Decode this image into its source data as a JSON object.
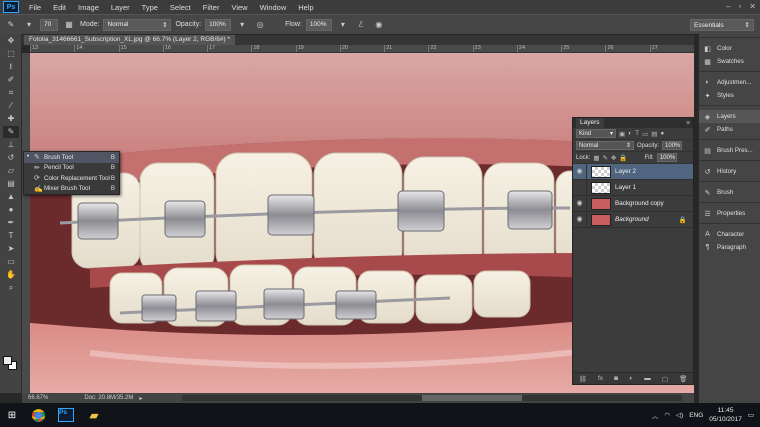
{
  "app": {
    "logo": "Ps",
    "menu": [
      "File",
      "Edit",
      "Image",
      "Layer",
      "Type",
      "Select",
      "Filter",
      "View",
      "Window",
      "Help"
    ]
  },
  "options_bar": {
    "brush_size": "70",
    "mode_label": "Mode:",
    "mode_value": "Normal",
    "opacity_label": "Opacity:",
    "opacity_value": "100%",
    "flow_label": "Flow:",
    "flow_value": "100%",
    "workspace": "Essentials"
  },
  "document": {
    "tab_title": "Fotolia_31466661_Subscription_XL.jpg @ 66.7% (Layer 2, RGB/8#) *",
    "ruler_ticks": [
      "13",
      "14",
      "15",
      "16",
      "17",
      "18",
      "19",
      "20",
      "21",
      "22",
      "23",
      "24",
      "25",
      "26",
      "27"
    ],
    "zoom": "66.67%",
    "doc_size": "Doc: 20.8M/35.2M"
  },
  "tool_flyout": {
    "items": [
      {
        "label": "Brush Tool",
        "key": "B",
        "icon": "brush-icon",
        "selected": true
      },
      {
        "label": "Pencil Tool",
        "key": "B",
        "icon": "pencil-icon",
        "selected": false
      },
      {
        "label": "Color Replacement Tool",
        "key": "B",
        "icon": "color-replacement-icon",
        "selected": false
      },
      {
        "label": "Mixer Brush Tool",
        "key": "B",
        "icon": "mixer-brush-icon",
        "selected": false
      }
    ]
  },
  "layers_panel": {
    "title": "Layers",
    "filter_kind": "Kind",
    "blend_mode": "Normal",
    "opacity_label": "Opacity:",
    "opacity_value": "100%",
    "lock_label": "Lock:",
    "fill_label": "Fill:",
    "fill_value": "100%",
    "layers": [
      {
        "name": "Layer 2",
        "thumb": "checker",
        "visible": true,
        "selected": true,
        "locked": false
      },
      {
        "name": "Layer 1",
        "thumb": "checker",
        "visible": false,
        "selected": false,
        "locked": false
      },
      {
        "name": "Background copy",
        "thumb": "photo",
        "visible": true,
        "selected": false,
        "locked": false
      },
      {
        "name": "Background",
        "thumb": "photo",
        "visible": true,
        "selected": false,
        "locked": true
      }
    ]
  },
  "dock": {
    "items": [
      {
        "label": "Color",
        "icon": "color-icon"
      },
      {
        "label": "Swatches",
        "icon": "swatches-icon"
      },
      {
        "label": "Adjustmen...",
        "icon": "adjustments-icon"
      },
      {
        "label": "Styles",
        "icon": "styles-icon"
      },
      {
        "label": "Layers",
        "icon": "layers-icon"
      },
      {
        "label": "Paths",
        "icon": "paths-icon"
      },
      {
        "label": "Brush Pres...",
        "icon": "brush-presets-icon"
      },
      {
        "label": "History",
        "icon": "history-icon"
      },
      {
        "label": "Brush",
        "icon": "brush-panel-icon"
      },
      {
        "label": "Properties",
        "icon": "properties-icon"
      },
      {
        "label": "Character",
        "icon": "character-icon"
      },
      {
        "label": "Paragraph",
        "icon": "paragraph-icon"
      }
    ]
  },
  "taskbar": {
    "language": "ENG",
    "time": "11:45",
    "date": "05/10/2017"
  },
  "colors": {
    "accent": "#506580",
    "ps_blue": "#31a8ff",
    "gum": "#b86a6a"
  }
}
